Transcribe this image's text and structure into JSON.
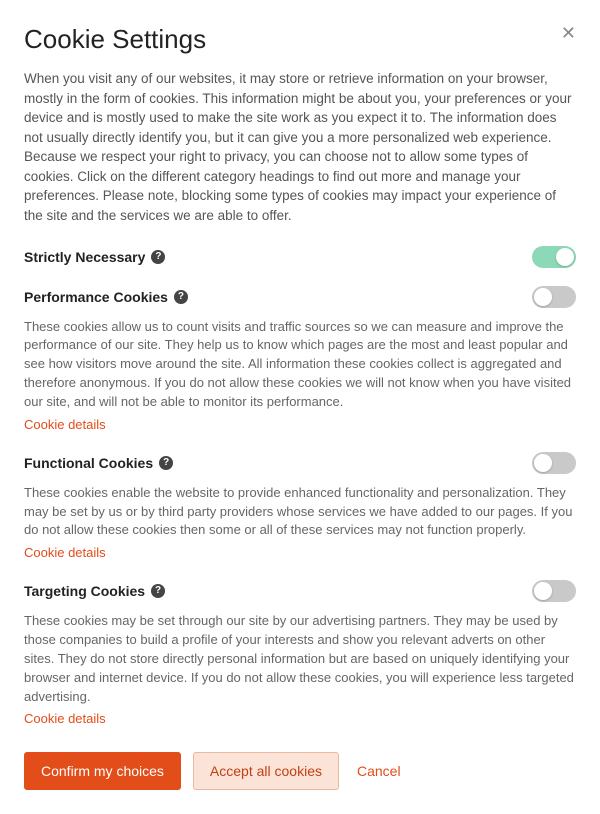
{
  "title": "Cookie Settings",
  "intro": "When you visit any of our websites, it may store or retrieve information on your browser, mostly in the form of cookies. This information might be about you, your preferences or your device and is mostly used to make the site work as you expect it to. The information does not usually directly identify you, but it can give you a more personalized web experience. Because we respect your right to privacy, you can choose not to allow some types of cookies. Click on the different category headings to find out more and manage your preferences. Please note, blocking some types of cookies may impact your experience of the site and the services we are able to offer.",
  "details_label": "Cookie details",
  "categories": {
    "strictly_necessary": {
      "title": "Strictly Necessary",
      "enabled": true,
      "locked": true
    },
    "performance": {
      "title": "Performance Cookies",
      "enabled": false,
      "desc": "These cookies allow us to count visits and traffic sources so we can measure and improve the performance of our site. They help us to know which pages are the most and least popular and see how visitors move around the site. All information these cookies collect is aggregated and therefore anonymous. If you do not allow these cookies we will not know when you have visited our site, and will not be able to monitor its performance."
    },
    "functional": {
      "title": "Functional Cookies",
      "enabled": false,
      "desc": "These cookies enable the website to provide enhanced functionality and personalization. They may be set by us or by third party providers whose services we have added to our pages. If you do not allow these cookies then some or all of these services may not function properly."
    },
    "targeting": {
      "title": "Targeting Cookies",
      "enabled": false,
      "desc": "These cookies may be set through our site by our advertising partners. They may be used by those companies to build a profile of your interests and show you relevant adverts on other sites. They do not store directly personal information but are based on uniquely identifying your browser and internet device. If you do not allow these cookies, you will experience less targeted advertising."
    }
  },
  "buttons": {
    "confirm": "Confirm my choices",
    "accept_all": "Accept all cookies",
    "cancel": "Cancel"
  }
}
